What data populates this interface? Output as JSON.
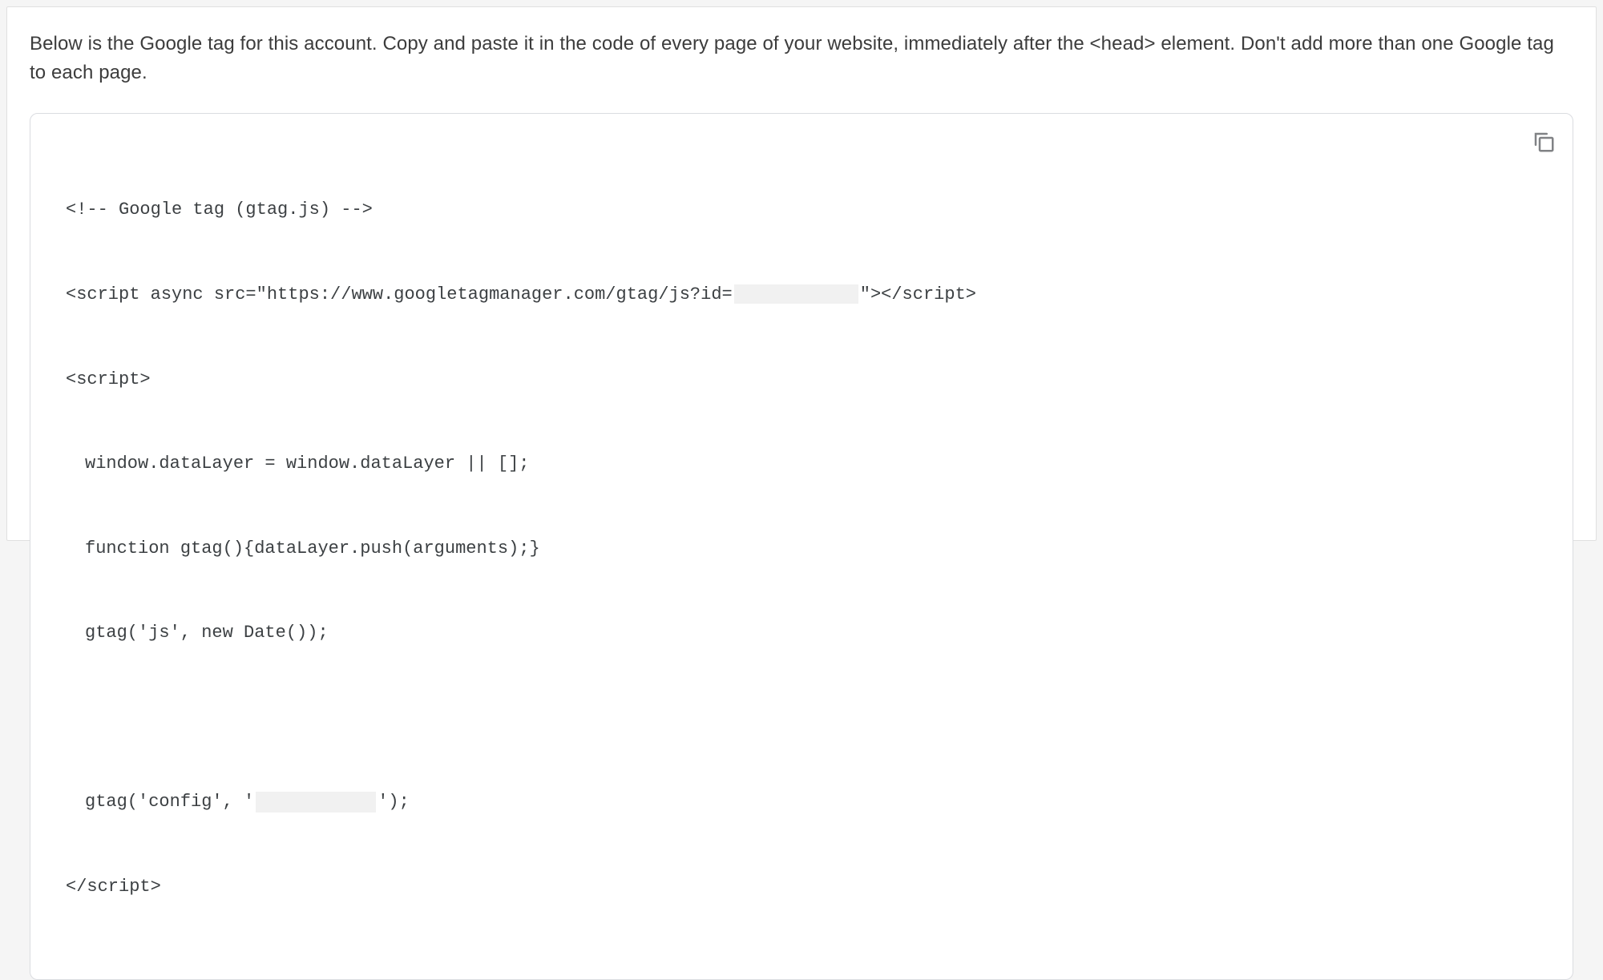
{
  "description": "Below is the Google tag for this account. Copy and paste it in the code of every page of your website, immediately after the <head> element. Don't add more than one Google tag to each page.",
  "code": {
    "line1": "<!-- Google tag (gtag.js) -->",
    "line2_a": "<script async src=\"https://www.googletagmanager.com/gtag/js?id=",
    "line2_b": "\"></script>",
    "line3": "<script>",
    "line4": "window.dataLayer = window.dataLayer || [];",
    "line5": "function gtag(){dataLayer.push(arguments);}",
    "line6": "gtag('js', new Date());",
    "line7": "",
    "line8_a": "gtag('config', '",
    "line8_b": "');",
    "line9": "</script>"
  }
}
